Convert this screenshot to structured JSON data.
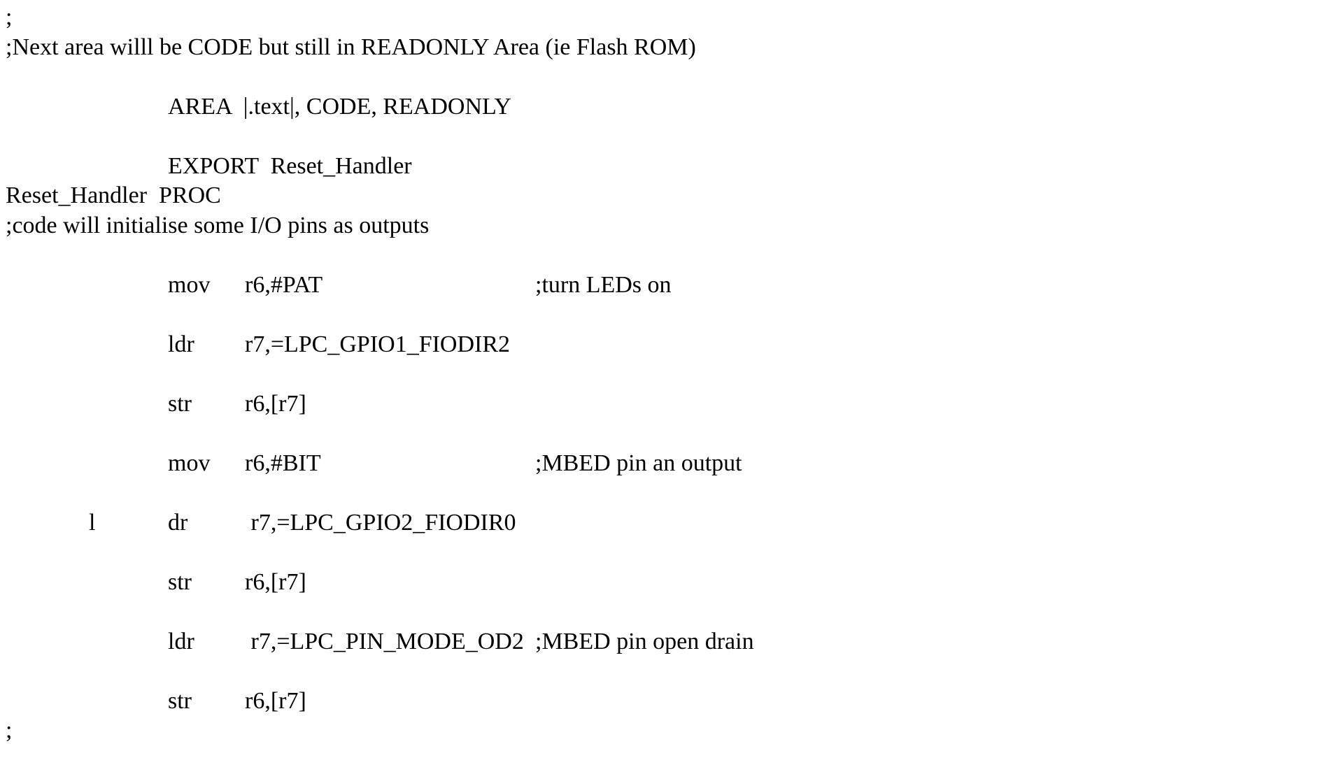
{
  "lines": {
    "l1": ";",
    "l2": ";Next area willl be CODE but still in READONLY Area (ie Flash ROM)",
    "l3_indent": "",
    "l3_op": "AREA",
    "l3_arg": "|.text|, CODE, READONLY",
    "l4_indent": "",
    "l4_op": "EXPORT",
    "l4_arg": "Reset_Handler",
    "l5": "Reset_Handler  PROC",
    "l6": ";code will initialise some I/O pins as outputs",
    "l7_indent": "",
    "l7_op": "mov",
    "l7_arg": "r6,#PAT",
    "l7_cmt": ";turn LEDs on",
    "l8_indent": "",
    "l8_op": "ldr",
    "l8_arg": "r7,=LPC_GPIO1_FIODIR2",
    "l8_cmt": "",
    "l9_indent": "",
    "l9_op": "str",
    "l9_arg": "r6,[r7]",
    "l9_cmt": "",
    "l10_indent": "",
    "l10_op": "mov",
    "l10_arg": "r6,#BIT",
    "l10_cmt": ";MBED pin an output",
    "l11_indent": "            l",
    "l11_op": "dr",
    "l11_arg": " r7,=LPC_GPIO2_FIODIR0",
    "l11_cmt": "",
    "l12_indent": "",
    "l12_op": "str",
    "l12_arg": "r6,[r7]",
    "l12_cmt": "",
    "l13_indent": "",
    "l13_op": "ldr",
    "l13_arg": " r7,=LPC_PIN_MODE_OD2",
    "l13_cmt": ";MBED pin open drain",
    "l14_indent": "",
    "l14_op": "str",
    "l14_arg": "r6,[r7]",
    "l14_cmt": "",
    "l15": ";"
  }
}
